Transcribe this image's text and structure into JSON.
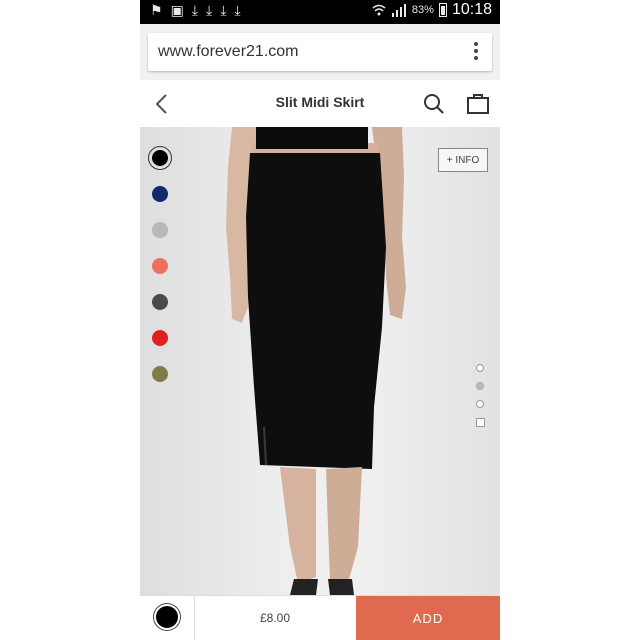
{
  "status_bar": {
    "left_icons": [
      "flag-icon",
      "image-icon",
      "download-icon",
      "download-icon",
      "download-icon",
      "download-icon"
    ],
    "battery_percent": "83%",
    "time": "10:18"
  },
  "browser": {
    "url": "www.forever21.com"
  },
  "header": {
    "title": "Slit Midi Skirt"
  },
  "product": {
    "info_button": "+ INFO",
    "swatches": [
      {
        "name": "black",
        "color": "#000000",
        "selected": true
      },
      {
        "name": "navy",
        "color": "#14286e"
      },
      {
        "name": "heather-grey",
        "color": "#b8b8b8"
      },
      {
        "name": "coral",
        "color": "#f07060"
      },
      {
        "name": "charcoal",
        "color": "#4a4a4a"
      },
      {
        "name": "red",
        "color": "#e02020"
      },
      {
        "name": "olive",
        "color": "#7d7d4a"
      }
    ],
    "image_pager": {
      "count": 4,
      "active_index": 1,
      "last_is_video": true
    }
  },
  "bottom_bar": {
    "selected_color": "#000000",
    "price": "£8.00",
    "add_label": "ADD",
    "add_color": "#e06a50"
  }
}
